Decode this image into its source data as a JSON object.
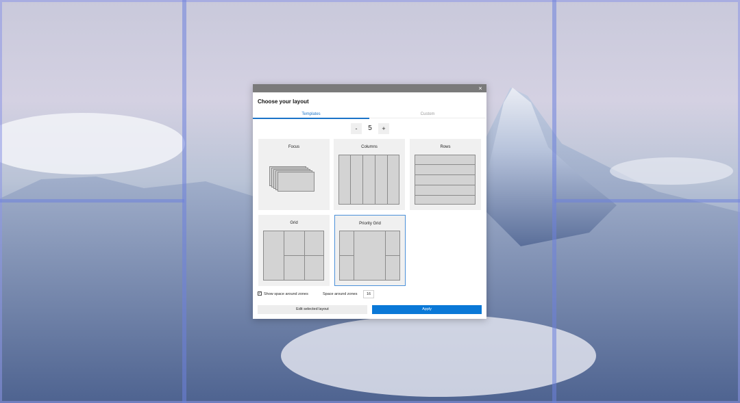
{
  "dialog": {
    "close_glyph": "×",
    "heading": "Choose your layout",
    "tabs": [
      {
        "label": "Templates",
        "active": true
      },
      {
        "label": "Custom",
        "active": false
      }
    ],
    "stepper": {
      "minus": "-",
      "value": "5",
      "plus": "+"
    },
    "templates": [
      {
        "name": "Focus"
      },
      {
        "name": "Columns"
      },
      {
        "name": "Rows"
      },
      {
        "name": "Grid"
      },
      {
        "name": "Priority Grid",
        "selected": true
      }
    ],
    "show_space_checked": true,
    "check_glyph": "✓",
    "show_space_label": "Show space around zones",
    "space_label": "Space around zones",
    "space_value": "16",
    "edit_button": "Edit selected layout",
    "apply_button": "Apply"
  },
  "colors": {
    "accent": "#0a78d7",
    "zone_overlay": "#6e82dc"
  }
}
